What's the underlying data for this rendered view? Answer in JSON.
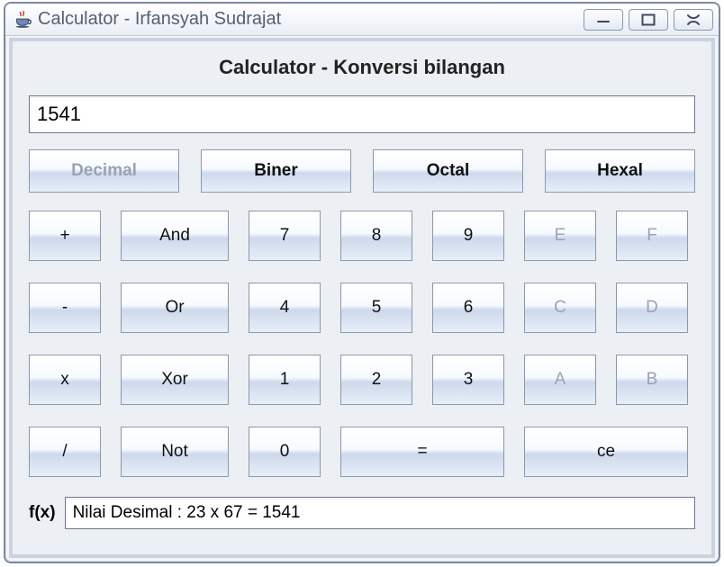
{
  "window": {
    "title": "Calculator - Irfansyah Sudrajat"
  },
  "heading": "Calculator - Konversi bilangan",
  "display_value": "1541",
  "bases": {
    "decimal": "Decimal",
    "biner": "Biner",
    "octal": "Octal",
    "hexal": "Hexal"
  },
  "keys": {
    "plus": "+",
    "minus": "-",
    "mul": "x",
    "div": "/",
    "and": "And",
    "or": "Or",
    "xor": "Xor",
    "not": "Not",
    "d0": "0",
    "d1": "1",
    "d2": "2",
    "d3": "3",
    "d4": "4",
    "d5": "5",
    "d6": "6",
    "d7": "7",
    "d8": "8",
    "d9": "9",
    "ha": "A",
    "hb": "B",
    "hc": "C",
    "hd": "D",
    "he": "E",
    "hf": "F",
    "eq": "=",
    "ce": "ce"
  },
  "footer": {
    "fx_label": "f(x)",
    "result_text": "Nilai Desimal : 23 x 67 = 1541"
  }
}
